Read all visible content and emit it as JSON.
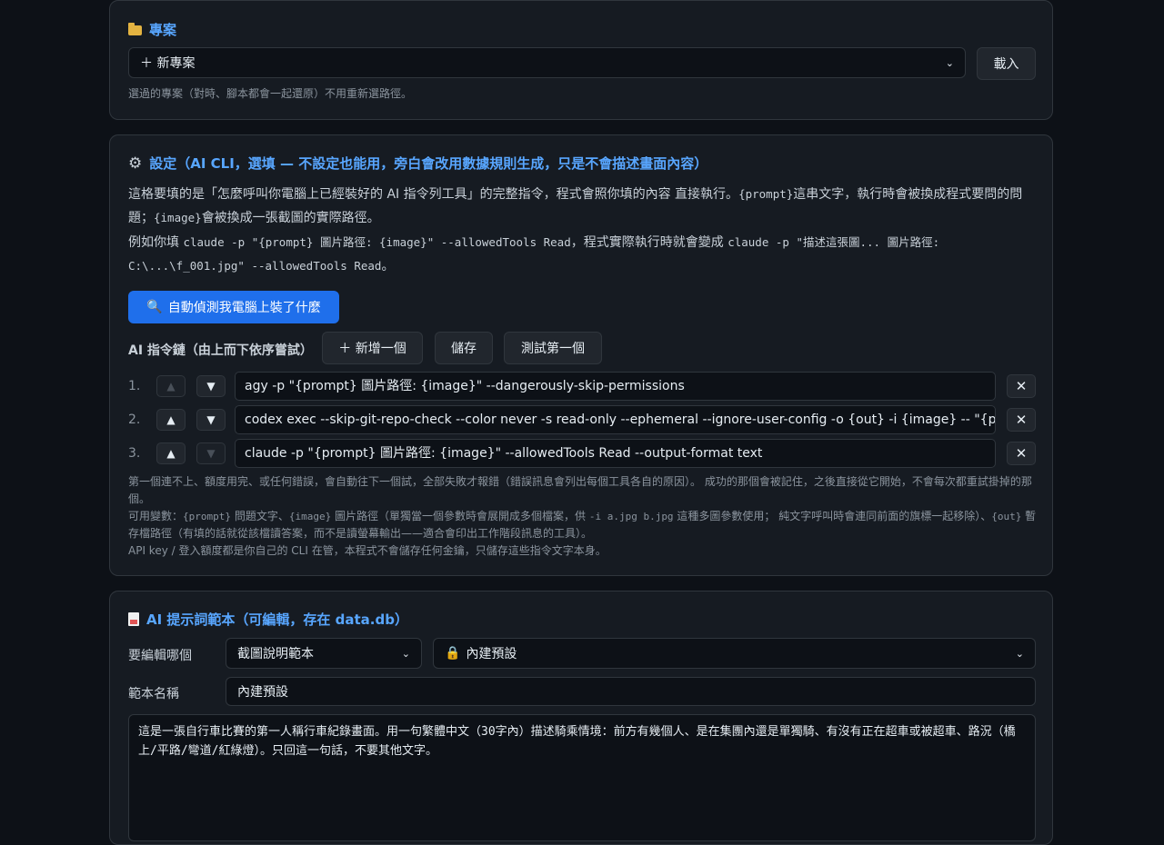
{
  "project": {
    "title": "專案",
    "select_value": "＋ 新專案",
    "load_label": "載入",
    "hint": "選過的專案（對時、腳本都會一起還原）不用重新選路徑。"
  },
  "settings": {
    "title": "設定（AI CLI，選填 — 不設定也能用，旁白會改用數據規則生成，只是不會描述畫面內容）",
    "desc1_a": "這格要填的是「怎麼呼叫你電腦上已經裝好的 AI 指令列工具」的完整指令，程式會照你填的內容 直接執行。",
    "desc1_code1": "{prompt}",
    "desc1_b": "這串文字，執行時會被換成程式要問的問題；",
    "desc1_code2": "{image}",
    "desc1_c": "會被換成一張截圖的實際路徑。",
    "desc2_a": "例如你填",
    "desc2_code1": "claude -p \"{prompt} 圖片路徑: {image}\" --allowedTools Read",
    "desc2_b": "，程式實際執行時就會變成",
    "desc2_code2": "claude -p \"描述這張圖... 圖片路徑: C:\\...\\f_001.jpg\" --allowedTools Read",
    "desc2_c": "。",
    "detect_label": "自動偵測我電腦上裝了什麼",
    "chain_label": "AI 指令鏈（由上而下依序嘗試）",
    "add_label": "＋ 新增一個",
    "save_label": "儲存",
    "test_label": "測試第一個",
    "commands": [
      {
        "num": "1.",
        "value": "agy -p \"{prompt} 圖片路徑: {image}\" --dangerously-skip-permissions"
      },
      {
        "num": "2.",
        "value": "codex exec --skip-git-repo-check --color never -s read-only --ephemeral --ignore-user-config -o {out} -i {image} -- \"{prompt}\""
      },
      {
        "num": "3.",
        "value": "claude -p \"{prompt} 圖片路徑: {image}\" --allowedTools Read --output-format text"
      }
    ],
    "hint1": "第一個連不上、額度用完、或任何錯誤，會自動往下一個試，全部失敗才報錯（錯誤訊息會列出每個工具各自的原因）。 成功的那個會被記住，之後直接從它開始，不會每次都重試掛掉的那個。",
    "hint2_a": "可用變數：",
    "hint2_c1": "{prompt}",
    "hint2_b": " 問題文字、",
    "hint2_c2": "{image}",
    "hint2_c": " 圖片路徑（單獨當一個參數時會展開成多個檔案，供",
    "hint2_c3": "-i a.jpg b.jpg",
    "hint2_d": " 這種多圖參數使用； 純文字呼叫時會連同前面的旗標一起移除）、",
    "hint2_c4": "{out}",
    "hint2_e": " 暫存檔路徑（有填的話就從該檔讀答案，而不是讀螢幕輸出——適合會印出工作階段訊息的工具）。",
    "hint3": "API key / 登入額度都是你自己的 CLI 在管，本程式不會儲存任何金鑰，只儲存這些指令文字本身。"
  },
  "prompt_template": {
    "title": "AI 提示詞範本（可編輯，存在 data.db）",
    "edit_label": "要編輯哪個",
    "type_select": "截圖說明範本",
    "preset_select": "內建預設",
    "name_label": "範本名稱",
    "name_value": "內建預設",
    "body": "這是一張自行車比賽的第一人稱行車紀錄畫面。用一句繁體中文（30字內）描述騎乘情境：前方有幾個人、是在集團內還是單獨騎、有沒有正在超車或被超車、路況（橋上/平路/彎道/紅綠燈）。只回這一句話，不要其他文字。"
  }
}
